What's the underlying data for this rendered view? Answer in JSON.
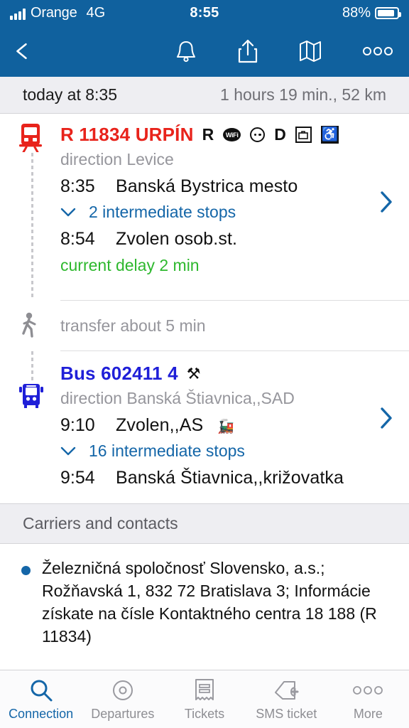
{
  "status_bar": {
    "carrier": "Orange",
    "network": "4G",
    "time": "8:55",
    "battery_percent": "88%"
  },
  "nav_bar": {
    "back_icon": "chevron-left-icon",
    "actions": [
      {
        "name": "bell-icon",
        "label": "Alerts"
      },
      {
        "name": "share-icon",
        "label": "Share"
      },
      {
        "name": "map-icon",
        "label": "Map"
      },
      {
        "name": "more-icon",
        "label": "More"
      }
    ]
  },
  "summary": {
    "departure": "today at 8:35",
    "duration_distance": "1 hours 19 min., 52 km"
  },
  "journey": {
    "segments": [
      {
        "mode": "train",
        "mode_icon": "train-icon",
        "line_name": "R 11834 URPÍN",
        "color": "#e8231b",
        "amenities": [
          {
            "name": "reservation-icon",
            "glyph": "R"
          },
          {
            "name": "wifi-icon",
            "glyph": "WiFi"
          },
          {
            "name": "power-socket-icon",
            "glyph": "socket"
          },
          {
            "name": "dining-icon",
            "glyph": "D"
          },
          {
            "name": "luggage-icon",
            "glyph": "luggage"
          },
          {
            "name": "wheelchair-icon",
            "glyph": "♿"
          }
        ],
        "direction": "direction Levice",
        "departure_time": "8:35",
        "departure_stop": "Banská Bystrica mesto",
        "intermediate_stops": "2 intermediate stops",
        "arrival_time": "8:54",
        "arrival_stop": "Zvolen osob.st.",
        "delay": "current delay 2 min"
      },
      {
        "mode": "bus",
        "mode_icon": "bus-icon",
        "line_name": "Bus 602411 4",
        "color": "#1f1fd8",
        "amenities": [
          {
            "name": "working-days-icon",
            "glyph": "⚒"
          }
        ],
        "direction": "direction Banská Štiavnica,,SAD",
        "departure_time": "9:10",
        "departure_stop": "Zvolen,,AS",
        "departure_stop_icon": "train-station-icon",
        "intermediate_stops": "16 intermediate stops",
        "arrival_time": "9:54",
        "arrival_stop": "Banská Štiavnica,,križovatka"
      }
    ],
    "transfer": {
      "icon": "walking-icon",
      "label": "transfer about 5 min"
    }
  },
  "carriers": {
    "header": "Carriers and contacts",
    "entries": [
      "Železničná spoločnosť Slovensko, a.s.; Rožňavská 1, 832 72 Bratislava 3; Informácie získate na čísle Kontaktného centra 18 188 (R 11834)"
    ]
  },
  "tab_bar": {
    "active_index": 0,
    "tabs": [
      {
        "label": "Connection",
        "icon": "search-icon"
      },
      {
        "label": "Departures",
        "icon": "clock-circle-icon"
      },
      {
        "label": "Tickets",
        "icon": "receipt-icon"
      },
      {
        "label": "SMS ticket",
        "icon": "ticket-plus-icon"
      },
      {
        "label": "More",
        "icon": "more-dots-icon"
      }
    ]
  },
  "colors": {
    "header_blue": "#10619e",
    "accent_blue": "#1466a8",
    "train_red": "#e8231b",
    "bus_blue": "#1f1fd8",
    "delay_green": "#2eb82e"
  }
}
